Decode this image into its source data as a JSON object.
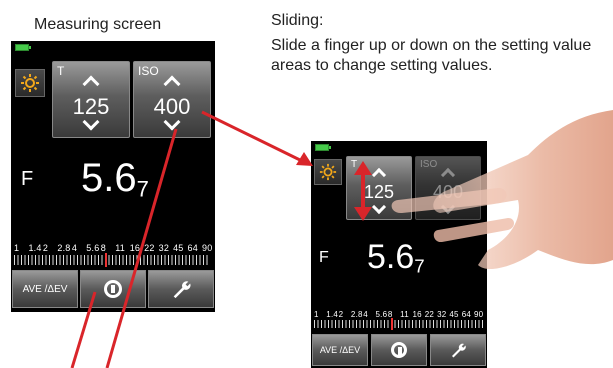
{
  "captions": {
    "measuring": "Measuring screen",
    "sliding_title": "Sliding:",
    "sliding_body": "Slide a finger up or down on the setting value areas to change setting values."
  },
  "device": {
    "t_label": "T",
    "t_value": "125",
    "iso_label": "ISO",
    "iso_value": "400",
    "f_label": "F",
    "f_value_main": "5.6",
    "f_value_tenths": "7",
    "scale_labels": [
      "1",
      "1.4",
      "2",
      "2.8",
      "4",
      "5.6",
      "8",
      "11",
      "16",
      "22",
      "32",
      "45",
      "64",
      "90"
    ],
    "ave_label": "AVE /ΔEV",
    "icons": [
      "battery-icon",
      "sun-icon",
      "chevron-up-icon",
      "chevron-down-icon",
      "dial-icon",
      "wrench-icon"
    ]
  },
  "colors": {
    "arrow": "#d9252a",
    "battery": "#46c94a",
    "sun": "#f3a81a",
    "screen_bg": "#000000"
  }
}
